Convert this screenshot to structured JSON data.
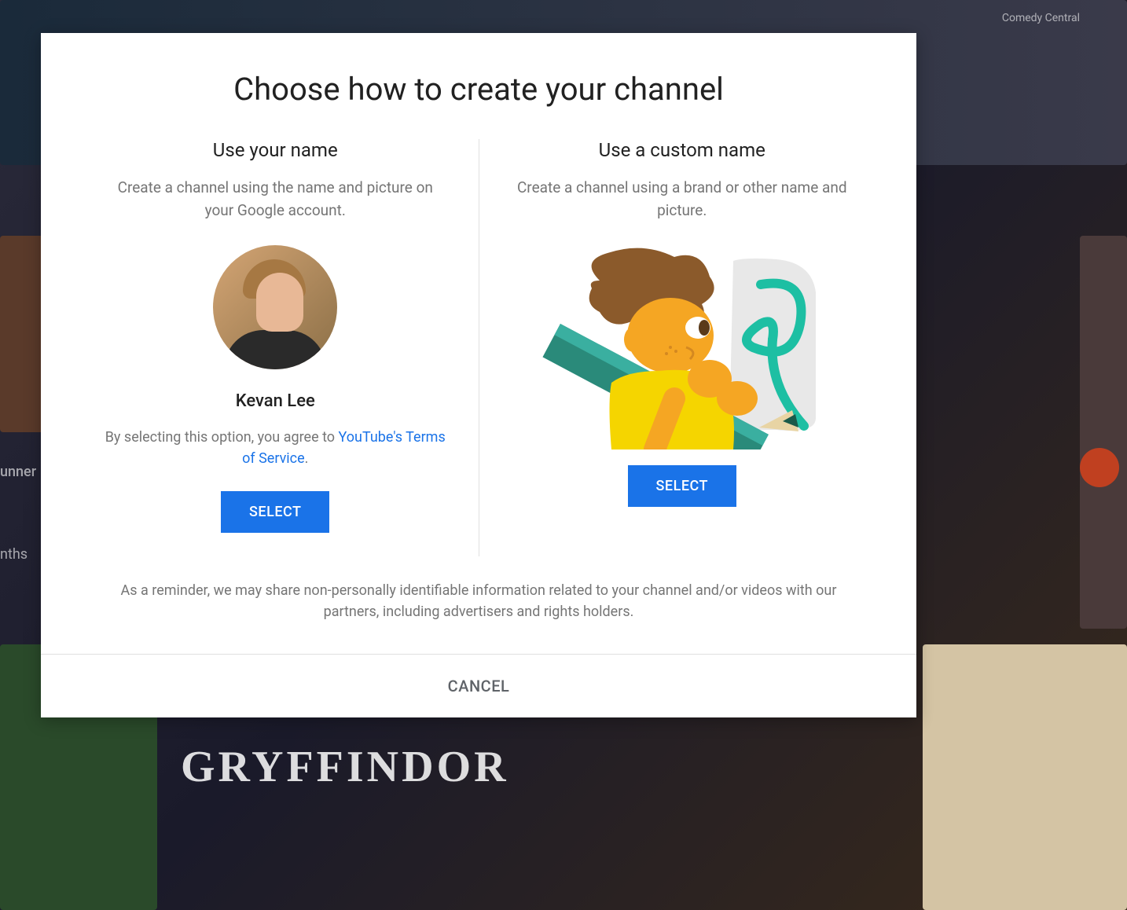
{
  "modal": {
    "title": "Choose how to create your channel",
    "left": {
      "title": "Use your name",
      "description": "Create a channel using the name and picture on your Google account.",
      "user_name": "Kevan Lee",
      "terms_prefix": "By selecting this option, you agree to ",
      "terms_link": "YouTube's Terms of Service",
      "terms_suffix": ".",
      "select_label": "SELECT"
    },
    "right": {
      "title": "Use a custom name",
      "description": "Create a channel using a brand or other name and picture.",
      "select_label": "SELECT"
    },
    "disclaimer": "As a reminder, we may share non-personally identifiable information related to your channel and/or videos with our partners, including advertisers and rights holders.",
    "cancel_label": "CANCEL"
  },
  "background": {
    "label_top": "Comedy Central",
    "label_left1": "unner",
    "label_left2": "nths",
    "label_bottom": "GRYFFINDOR"
  }
}
